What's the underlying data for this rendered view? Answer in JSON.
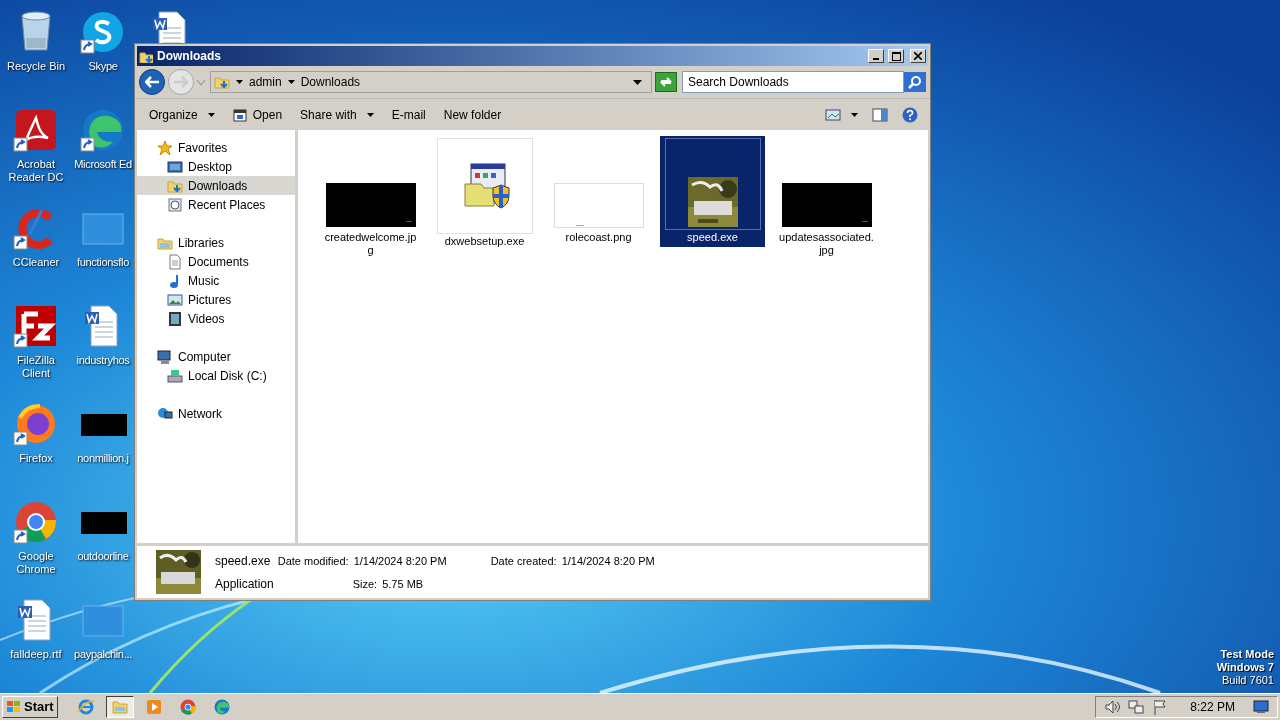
{
  "desktop": {
    "icons": [
      {
        "label": "Recycle Bin",
        "kind": "recycle",
        "shortcut": false
      },
      {
        "label": "Acrobat Reader DC",
        "kind": "acrobat",
        "shortcut": true
      },
      {
        "label": "CCleaner",
        "kind": "ccleaner",
        "shortcut": true
      },
      {
        "label": "FileZilla Client",
        "kind": "filezilla",
        "shortcut": true
      },
      {
        "label": "Firefox",
        "kind": "firefox",
        "shortcut": true
      },
      {
        "label": "Google Chrome",
        "kind": "chrome",
        "shortcut": true
      },
      {
        "label": "falldeep.rtf",
        "kind": "word",
        "shortcut": false
      },
      {
        "label": "Skype",
        "kind": "skype",
        "shortcut": true
      },
      {
        "label": "Microsoft Ed",
        "kind": "edge",
        "shortcut": true
      },
      {
        "label": "functionsflo",
        "kind": "blank",
        "shortcut": false
      },
      {
        "label": "industryhos",
        "kind": "word",
        "shortcut": false
      },
      {
        "label": "nonmillion.j",
        "kind": "black",
        "shortcut": false
      },
      {
        "label": "outdoorline",
        "kind": "black",
        "shortcut": false
      },
      {
        "label": "paypalchin...",
        "kind": "blank",
        "shortcut": false
      },
      {
        "kind": "word",
        "shortcut": false
      }
    ]
  },
  "window": {
    "title": "Downloads",
    "breadcrumb": [
      "admin",
      "Downloads"
    ],
    "search": {
      "placeholder": "Search Downloads"
    },
    "toolbar": [
      {
        "label": "Organize",
        "dropdown": true,
        "icon": false
      },
      {
        "label": "Open",
        "dropdown": false,
        "icon": true
      },
      {
        "label": "Share with",
        "dropdown": true,
        "icon": false
      },
      {
        "label": "E-mail",
        "dropdown": false,
        "icon": false
      },
      {
        "label": "New folder",
        "dropdown": false,
        "icon": false
      }
    ],
    "nav": [
      {
        "label": "Favorites",
        "kind": "star",
        "selected": false,
        "children": [
          {
            "label": "Desktop",
            "kind": "desktop",
            "selected": false
          },
          {
            "label": "Downloads",
            "kind": "downloads",
            "selected": true
          },
          {
            "label": "Recent Places",
            "kind": "recent",
            "selected": false
          }
        ]
      },
      {
        "label": "Libraries",
        "kind": "library",
        "selected": false,
        "children": [
          {
            "label": "Documents",
            "kind": "document",
            "selected": false
          },
          {
            "label": "Music",
            "kind": "music",
            "selected": false
          },
          {
            "label": "Pictures",
            "kind": "pictures",
            "selected": false
          },
          {
            "label": "Videos",
            "kind": "videos",
            "selected": false
          }
        ]
      },
      {
        "label": "Computer",
        "kind": "computer",
        "selected": false,
        "children": [
          {
            "label": "Local Disk (C:)",
            "kind": "disk",
            "selected": false
          }
        ]
      },
      {
        "label": "Network",
        "kind": "network",
        "selected": false
      }
    ],
    "files": [
      {
        "name": "createdwelcome.jpg",
        "kind": "black",
        "selected": false
      },
      {
        "name": "dxwebsetup.exe",
        "kind": "installer",
        "selected": false
      },
      {
        "name": "rolecoast.png",
        "kind": "white",
        "selected": false
      },
      {
        "name": "speed.exe",
        "kind": "picture",
        "selected": true
      },
      {
        "name": "updatesassociated.jpg",
        "kind": "black",
        "selected": false
      }
    ],
    "details": {
      "name": "speed.exe",
      "type": "Application",
      "fields": [
        {
          "label": "Date modified:",
          "value": "1/14/2024 8:20 PM"
        },
        {
          "label": "Date created:",
          "value": "1/14/2024 8:20 PM"
        },
        {
          "label": "Size:",
          "value": "5.75 MB"
        }
      ]
    }
  },
  "watermark": [
    "Test Mode",
    "Windows 7",
    "Build 7601"
  ],
  "taskbar": {
    "start": "Start",
    "apps": [
      {
        "kind": "ie",
        "active": false
      },
      {
        "kind": "explorer",
        "active": true
      },
      {
        "kind": "media",
        "active": false
      },
      {
        "kind": "chrome",
        "active": false
      },
      {
        "kind": "edge",
        "active": false
      }
    ],
    "clock": "8:22 PM"
  }
}
